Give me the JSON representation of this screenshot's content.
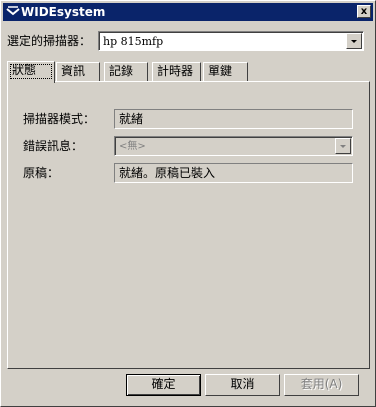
{
  "window": {
    "title": "WIDEsystem",
    "close_label": "x"
  },
  "scanner": {
    "label": "選定的掃描器：",
    "value": "hp 815mfp"
  },
  "tabs": [
    {
      "label": "狀態"
    },
    {
      "label": "資訊"
    },
    {
      "label": "記錄"
    },
    {
      "label": "計時器"
    },
    {
      "label": "單鍵"
    }
  ],
  "status": {
    "mode_label": "掃描器模式：",
    "mode_value": "就緒",
    "error_label": "錯誤訊息：",
    "error_value": "<無>",
    "original_label": "原稿：",
    "original_value": "就緒。原稿已裝入"
  },
  "buttons": {
    "ok": "確定",
    "cancel": "取消",
    "apply": "套用(A)"
  }
}
